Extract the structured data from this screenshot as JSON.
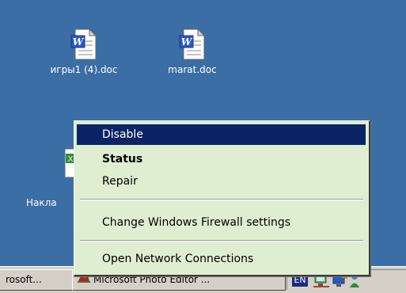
{
  "desktop": {
    "icons": [
      {
        "label": "игры1 (4).doc"
      },
      {
        "label": "marat.doc"
      }
    ],
    "partial_icon_label": "Накла"
  },
  "context_menu": {
    "items": [
      {
        "label": "Disable"
      },
      {
        "label": "Status"
      },
      {
        "label": "Repair"
      },
      {
        "label": "Change Windows Firewall settings"
      },
      {
        "label": "Open Network Connections"
      }
    ]
  },
  "taskbar": {
    "buttons": [
      {
        "label": "rosoft..."
      },
      {
        "label": "Microsoft Photo Editor ..."
      }
    ],
    "tray": {
      "language": "EN"
    }
  },
  "colors": {
    "desktop": "#3a6ea5",
    "menu_background": "#dfeed0",
    "menu_highlight": "#0b2466",
    "taskbar": "#d4d0c8"
  }
}
